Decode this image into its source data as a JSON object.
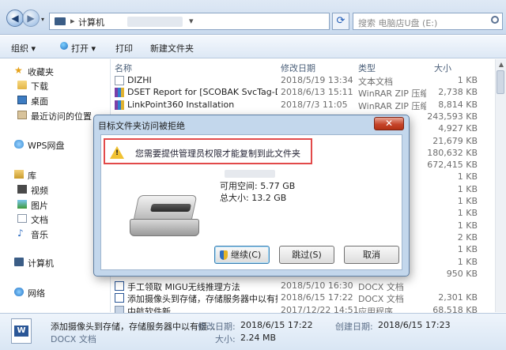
{
  "address": {
    "path_root": "计算机",
    "search_placeholder": "搜索 电脑店U盘 (E:)"
  },
  "toolbar": {
    "organize": "组织 ▾",
    "open": "打开 ▾",
    "print": "打印",
    "new_folder": "新建文件夹"
  },
  "nav": {
    "favorites": "收藏夹",
    "downloads": "下载",
    "desktop": "桌面",
    "recent": "最近访问的位置",
    "wps": "WPS网盘",
    "libraries": "库",
    "videos": "视频",
    "pictures": "图片",
    "documents": "文档",
    "music": "音乐",
    "computer": "计算机",
    "network": "网络"
  },
  "columns": {
    "name": "名称",
    "modified": "修改日期",
    "type": "类型",
    "size": "大小"
  },
  "files": [
    {
      "name": "DIZHI",
      "modified": "2018/5/19 13:34",
      "type": "文本文档",
      "size": "1 KB",
      "icon": "text-file"
    },
    {
      "name": "DSET Report for [SCOBAK SvcTag-D...",
      "modified": "2018/6/13 15:11",
      "type": "WinRAR ZIP 压缩...",
      "size": "2,738 KB",
      "icon": "zip-file"
    },
    {
      "name": "LinkPoint360 Installation",
      "modified": "2018/7/3 11:05",
      "type": "WinRAR ZIP 压缩...",
      "size": "8,814 KB",
      "icon": "zip-file"
    },
    {
      "name": "",
      "modified": "",
      "type": "",
      "size": "243,593 KB",
      "icon": ""
    },
    {
      "name": "",
      "modified": "",
      "type": "",
      "size": "4,927 KB",
      "icon": ""
    },
    {
      "name": "",
      "modified": "",
      "type": "",
      "size": "21,679 KB",
      "icon": ""
    },
    {
      "name": "",
      "modified": "",
      "type": "",
      "size": "180,632 KB",
      "icon": ""
    },
    {
      "name": "",
      "modified": "",
      "type": "",
      "size": "672,415 KB",
      "icon": ""
    },
    {
      "name": "",
      "modified": "",
      "type": "",
      "size": "1 KB",
      "icon": ""
    },
    {
      "name": "",
      "modified": "",
      "type": "",
      "size": "1 KB",
      "icon": ""
    },
    {
      "name": "",
      "modified": "",
      "type": "",
      "size": "1 KB",
      "icon": ""
    },
    {
      "name": "",
      "modified": "",
      "type": "",
      "size": "1 KB",
      "icon": ""
    },
    {
      "name": "",
      "modified": "",
      "type": "",
      "size": "1 KB",
      "icon": ""
    },
    {
      "name": "",
      "modified": "",
      "type": "",
      "size": "2 KB",
      "icon": ""
    },
    {
      "name": "",
      "modified": "",
      "type": "",
      "size": "1 KB",
      "icon": ""
    },
    {
      "name": "",
      "modified": "",
      "type": "",
      "size": "1 KB",
      "icon": ""
    },
    {
      "name": "",
      "modified": "",
      "type": "",
      "size": "950 KB",
      "icon": ""
    },
    {
      "name": "手工领取 MIGU无线推理方法",
      "modified": "2018/5/10 16:30",
      "type": "DOCX 文档",
      "size": "",
      "icon": "docx-file"
    },
    {
      "name": "添加摄像头到存储，存储服务器中以有摄...",
      "modified": "2018/6/15 17:22",
      "type": "DOCX 文档",
      "size": "2,301 KB",
      "icon": "docx-file"
    },
    {
      "name": "中航软件新",
      "modified": "2017/12/22 14:51",
      "type": "应用程序",
      "size": "68,518 KB",
      "icon": "exe-file"
    }
  ],
  "details": {
    "filename": "添加摄像头到存储，存储服务器中以有摄...",
    "filetype": "DOCX 文档",
    "modified_label": "修改日期:",
    "modified_value": "2018/6/15 17:22",
    "created_label": "创建日期:",
    "created_value": "2018/6/15 17:23",
    "size_label": "大小:",
    "size_value": "2.24 MB",
    "icon_letter": "W"
  },
  "dialog": {
    "title": "目标文件夹访问被拒绝",
    "close": "✕",
    "message": "您需要提供管理员权限才能复制到此文件夹",
    "free_space": "可用空间: 5.77 GB",
    "total_size": "总大小: 13.2 GB",
    "continue": "继续(C)",
    "skip": "跳过(S)",
    "cancel": "取消"
  }
}
